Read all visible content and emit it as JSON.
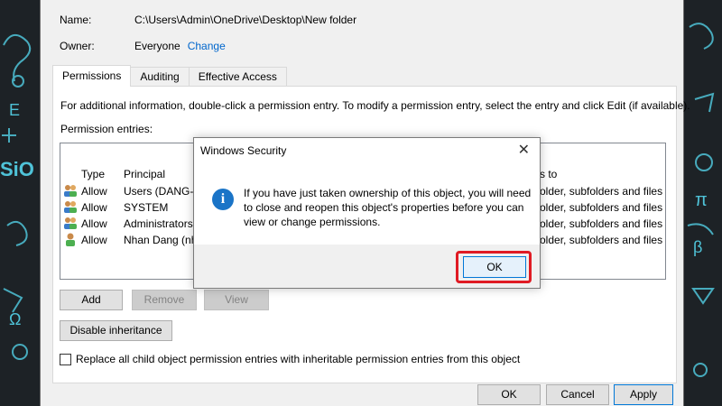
{
  "window": {
    "name_label": "Name:",
    "name_value": "C:\\Users\\Admin\\OneDrive\\Desktop\\New folder",
    "owner_label": "Owner:",
    "owner_value": "Everyone",
    "owner_change_link": "Change"
  },
  "tabs": [
    {
      "label": "Permissions",
      "active": true
    },
    {
      "label": "Auditing",
      "active": false
    },
    {
      "label": "Effective Access",
      "active": false
    }
  ],
  "permissions": {
    "intro_text": "For additional information, double-click a permission entry. To modify a permission entry, select the entry and click Edit (if available).",
    "entries_label": "Permission entries:",
    "columns": {
      "type": "Type",
      "principal": "Principal",
      "applies_partial": "s to"
    },
    "rows": [
      {
        "type": "Allow",
        "principal": "Users (DANG-N",
        "applies": "older, subfolders and files",
        "icon": "users-group-icon"
      },
      {
        "type": "Allow",
        "principal": "SYSTEM",
        "applies": "older, subfolders and files",
        "icon": "users-group-icon"
      },
      {
        "type": "Allow",
        "principal": "Administrators (",
        "applies": "older, subfolders and files",
        "icon": "users-group-icon"
      },
      {
        "type": "Allow",
        "principal": "Nhan Dang (nha",
        "applies": "older, subfolders and files",
        "icon": "user-icon"
      }
    ],
    "buttons": {
      "add": "Add",
      "remove": "Remove",
      "view": "View"
    },
    "disable_inheritance": "Disable inheritance",
    "replace_checkbox_label": "Replace all child object permission entries with inheritable permission entries from this object"
  },
  "footer": {
    "ok": "OK",
    "cancel": "Cancel",
    "apply": "Apply"
  },
  "dialog": {
    "title": "Windows Security",
    "close_glyph": "✕",
    "info_glyph": "i",
    "message": "If you have just taken ownership of this object, you will need to close and reopen this object's properties before you can view or change permissions.",
    "ok_label": "OK",
    "highlight_color": "#e01b24"
  },
  "colors": {
    "accent": "#0078d7",
    "link": "#0066cc",
    "background": "#1d2226"
  }
}
